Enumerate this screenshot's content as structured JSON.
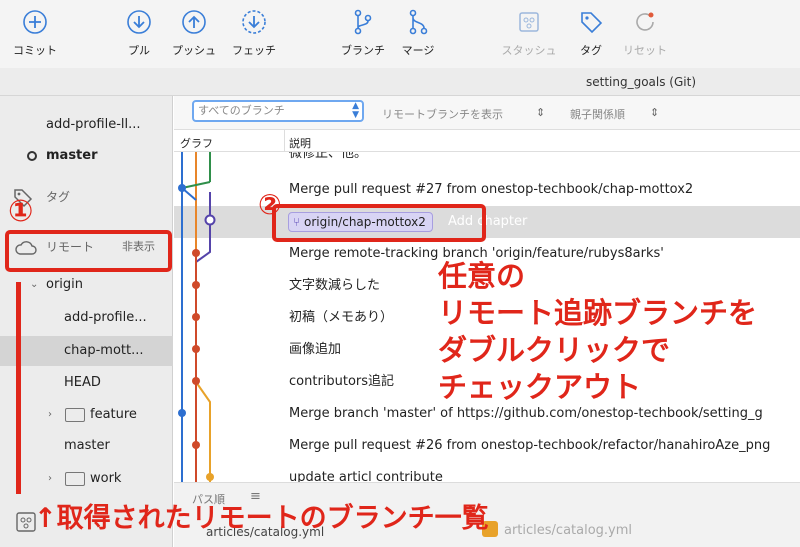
{
  "toolbar": {
    "commit": "コミット",
    "pull": "プル",
    "push": "プッシュ",
    "fetch": "フェッチ",
    "branch": "ブランチ",
    "merge": "マージ",
    "stash": "スタッシュ",
    "tag": "タグ",
    "reset": "リセット"
  },
  "window_title": "setting_goals (Git)",
  "sidebar": {
    "branch_top": "add-profile-ll...",
    "branch_master": "master",
    "tags": "タグ",
    "remotes": "リモート",
    "hide": "非表示",
    "origin": "origin",
    "remote_items": [
      "add-profile...",
      "chap-mott...",
      "HEAD",
      "feature",
      "master",
      "work"
    ]
  },
  "filter": {
    "branch_select": "すべてのブランチ",
    "show_remote": "リモートブランチを表示",
    "order": "親子関係順"
  },
  "columns": {
    "graph": "グラフ",
    "description": "説明"
  },
  "commits": [
    "微修正、他。",
    "Merge pull request #27 from onestop-techbook/chap-mottox2",
    "Add chapter",
    "Merge remote-tracking branch 'origin/feature/rubys8arks'",
    "文字数減らした",
    "初稿（メモあり）",
    "画像追加",
    "contributors追記",
    "Merge branch 'master' of https://github.com/onestop-techbook/setting_g",
    "Merge pull request #26 from onestop-techbook/refactor/hanahiroAze_png",
    "update articl contribute"
  ],
  "branch_tag": "origin/chap-mottox2",
  "bottom": {
    "path_sort": "パス順",
    "list_icon": "≡",
    "file_left": "articles/catalog.yml",
    "file_right": "articles/catalog.yml"
  },
  "annotations": {
    "num1": "①",
    "num2": "②",
    "note_lines": [
      "任意の",
      "リモート追跡ブランチを",
      "ダブルクリックで",
      "チェックアウト"
    ],
    "bottom_note": "↑取得されたリモートのブランチ一覧"
  },
  "colors": {
    "accent": "#3a7ed8",
    "annotation": "#e0261a",
    "branch_blue": "#2d6fd0"
  }
}
